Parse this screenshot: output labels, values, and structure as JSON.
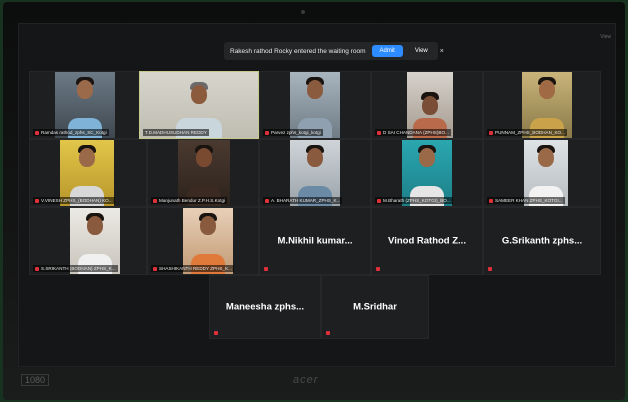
{
  "notification": {
    "message": "Rakesh rathod Rocky entered the waiting room",
    "admit_label": "Admit",
    "view_label": "View",
    "close_glyph": "×"
  },
  "view_tag": "View",
  "participants_video": [
    {
      "name": "Ramdas rathod_zphs_SC_Kotgi",
      "muted": true
    },
    {
      "name": "T.D.MADHUSUDHAN REDDY",
      "muted": false
    },
    {
      "name": "Parvez zphs_kotgi_kotgi",
      "muted": true
    },
    {
      "name": "D SAI CHANDANA (ZPHS)BO...",
      "muted": true
    },
    {
      "name": "PUNNAM_ZPHS_BODHAN_KO...",
      "muted": true
    },
    {
      "name": "V.VINESH ZPHS_(BODHAN) KO...",
      "muted": true
    },
    {
      "name": "Manjunath Bendur Z.P.H.S.Kotgi",
      "muted": true
    },
    {
      "name": "A. BHARATH KUMAR_ZPHS_K...",
      "muted": true
    },
    {
      "name": "M.Bharath (ZPHS_KOTGI)_BO...",
      "muted": true
    },
    {
      "name": "SAMEER KHAN ZPHS_KOTGI...",
      "muted": true
    },
    {
      "name": "S.SRIKANTH (BODHAN) ZPHS_K...",
      "muted": true
    },
    {
      "name": "SHASHIKANTH REDDY ZPHS_K...",
      "muted": true
    }
  ],
  "participants_name_only": [
    {
      "name": "M.Nikhil kumar..."
    },
    {
      "name": "Vinod Rathod Z..."
    },
    {
      "name": "G.Srikanth zphs..."
    },
    {
      "name": "Maneesha zphs..."
    },
    {
      "name": "M.Sridhar"
    }
  ],
  "monitor": {
    "resolution_badge": "1080",
    "brand": "acer"
  },
  "colors": {
    "admit_blue": "#2d8cff",
    "muted_red": "#e0303a",
    "speaker_border": "#c7c98a",
    "tile_bg": "#1e1f20"
  }
}
